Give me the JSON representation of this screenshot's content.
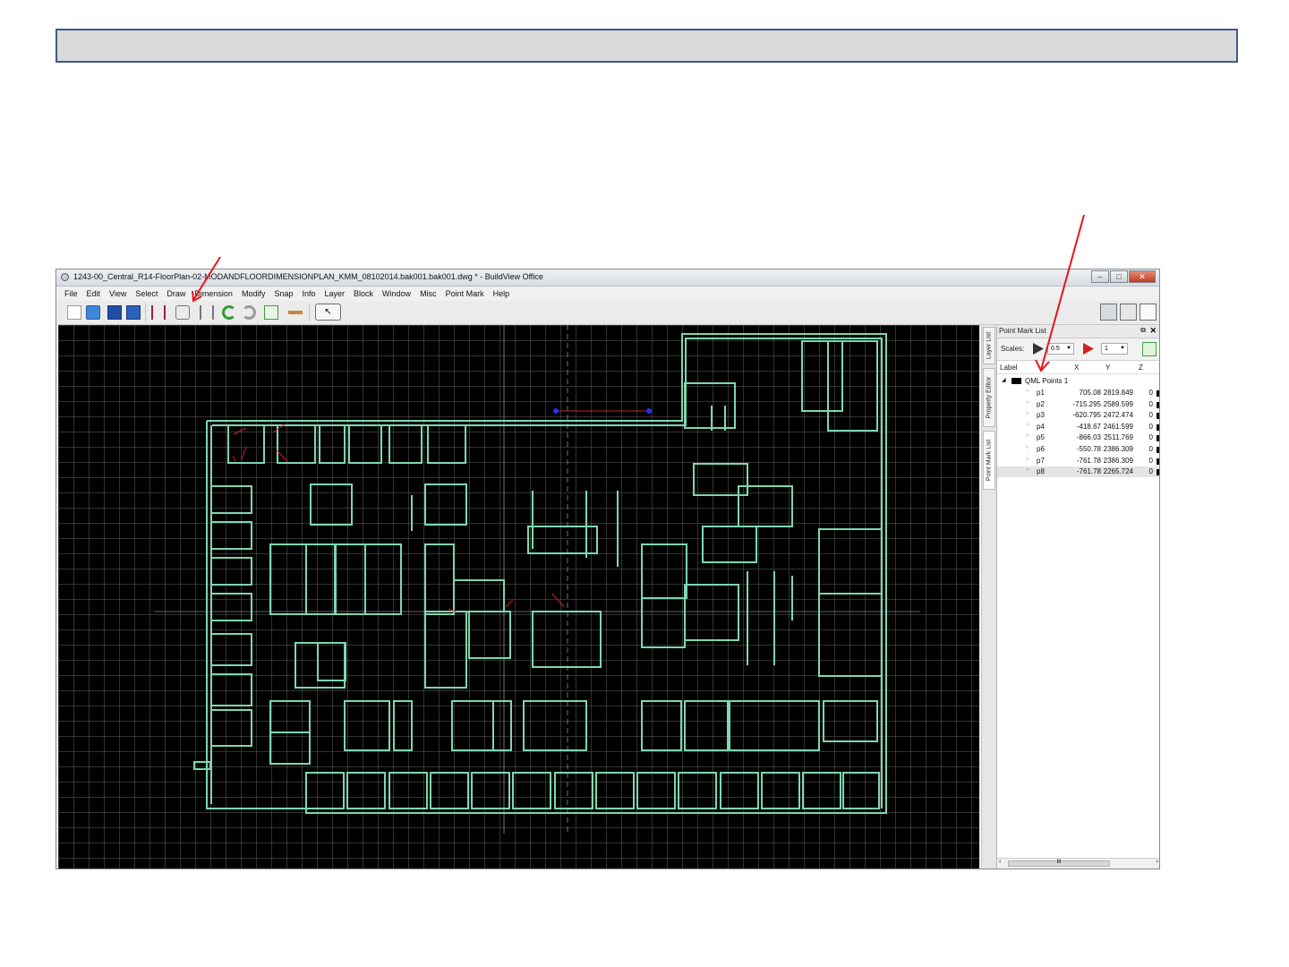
{
  "window": {
    "title": "1243-00_Central_R14-FloorPlan-02-MODANDFLOORDIMENSIONPLAN_KMM_08102014.bak001.bak001.dwg * - BuildView Office",
    "controls": [
      "–",
      "□",
      "✕"
    ]
  },
  "menu": [
    "File",
    "Edit",
    "View",
    "Select",
    "Draw",
    "Dimension",
    "Modify",
    "Snap",
    "Info",
    "Layer",
    "Block",
    "Window",
    "Misc",
    "Point Mark",
    "Help"
  ],
  "toolbar": {
    "icons": [
      "new-icon",
      "open-folder-icon",
      "save-icon",
      "save-as-icon",
      "dimension-icon",
      "point-mark-icon",
      "dimension-2-icon",
      "undo-icon",
      "redo-icon",
      "export-icon",
      "measure-icon",
      "pointer-icon",
      "layout-1-icon",
      "layout-2-icon",
      "layout-3-icon"
    ]
  },
  "side_tabs": [
    "Layer List",
    "Property Editor",
    "Point Mark List"
  ],
  "panel": {
    "title": "Point Mark List",
    "pin_glyph": "⧉",
    "close_glyph": "✕",
    "scales_label": "Scales:",
    "scale_1": "0.5",
    "scale_2": "1",
    "columns": {
      "label": "Label",
      "x": "X",
      "y": "Y",
      "z": "Z"
    },
    "group": "QML Points 1",
    "points": [
      {
        "label": "p1",
        "x": "705.08",
        "y": "2819.849",
        "z": "0"
      },
      {
        "label": "p2",
        "x": "-715.295",
        "y": "2589.599",
        "z": "0"
      },
      {
        "label": "p3",
        "x": "-620.795",
        "y": "2472.474",
        "z": "0"
      },
      {
        "label": "p4",
        "x": "-418.67",
        "y": "2461.599",
        "z": "0"
      },
      {
        "label": "p5",
        "x": "-866.03",
        "y": "2511.769",
        "z": "0"
      },
      {
        "label": "p6",
        "x": "-550.78",
        "y": "2386.309",
        "z": "0"
      },
      {
        "label": "p7",
        "x": "-761.78",
        "y": "2386.309",
        "z": "0"
      },
      {
        "label": "p8",
        "x": "-761.78",
        "y": "2265.724",
        "z": "0"
      }
    ],
    "scroll_glyph": "III"
  },
  "colors": {
    "canvas_bg": "#000000",
    "walls": "#7fd6b0",
    "annotation_arrow": "#e8141c",
    "banner": "#d9d9d9"
  }
}
